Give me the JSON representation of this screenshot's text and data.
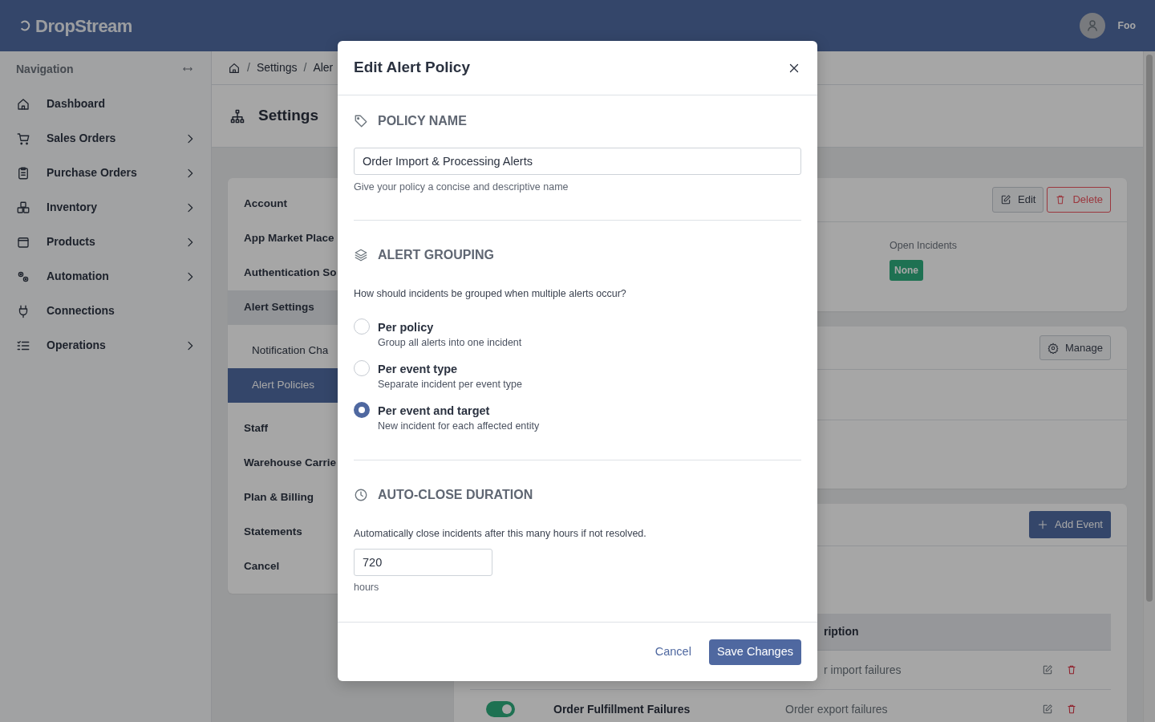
{
  "topbar": {
    "logo": "DropStream",
    "user": "Foo"
  },
  "sidebar": {
    "title": "Navigation",
    "items": [
      {
        "label": "Dashboard",
        "expandable": false
      },
      {
        "label": "Sales Orders",
        "expandable": true
      },
      {
        "label": "Purchase Orders",
        "expandable": true
      },
      {
        "label": "Inventory",
        "expandable": true
      },
      {
        "label": "Products",
        "expandable": true
      },
      {
        "label": "Automation",
        "expandable": true
      },
      {
        "label": "Connections",
        "expandable": false
      },
      {
        "label": "Operations",
        "expandable": true
      }
    ]
  },
  "breadcrumb": {
    "separator": "/",
    "items": [
      "Settings",
      "Aler"
    ]
  },
  "page_title": "Settings",
  "settings_menu": [
    {
      "label": "Account",
      "selected": false
    },
    {
      "label": "App Market Place",
      "selected": false
    },
    {
      "label": "Authentication So",
      "selected": false
    },
    {
      "label": "Alert Settings",
      "selected": false,
      "expanded": true,
      "children": [
        {
          "label": "Notification Cha",
          "selected": false
        },
        {
          "label": "Alert Policies",
          "selected": true
        }
      ]
    },
    {
      "label": "Staff",
      "selected": false
    },
    {
      "label": "Warehouse Carrie",
      "selected": false
    },
    {
      "label": "Plan & Billing",
      "selected": false
    },
    {
      "label": "Statements",
      "selected": false
    },
    {
      "label": "Cancel",
      "selected": false
    }
  ],
  "policy_card": {
    "buttons": [
      {
        "kind": "edit",
        "label": "Edit"
      },
      {
        "kind": "delete",
        "label": "Delete"
      }
    ],
    "open_incidents": {
      "label": "Open Incidents",
      "value": "None"
    }
  },
  "channels_card": {
    "button": "Manage"
  },
  "events_card": {
    "button": "Add Event",
    "table": {
      "columns": [
        {
          "label": "ription",
          "partial": true
        }
      ],
      "rows": [
        {
          "description": "r import failures",
          "partial": true
        },
        {
          "enabled": true,
          "name": "Order Fulfillment Failures",
          "description": "Order export failures",
          "partial": false
        }
      ]
    }
  },
  "dialog": {
    "title": "Edit Alert Policy",
    "sections": [
      {
        "kind": "name",
        "heading": "POLICY NAME",
        "value": "Order Import & Processing Alerts",
        "help": "Give your policy a concise and descriptive name"
      },
      {
        "kind": "grouping",
        "heading": "ALERT GROUPING",
        "question": "How should incidents be grouped when multiple alerts occur?",
        "options": [
          {
            "label": "Per policy",
            "description": "Group all alerts into one incident",
            "selected": false
          },
          {
            "label": "Per event type",
            "description": "Separate incident per event type",
            "selected": false
          },
          {
            "label": "Per event and target",
            "description": "New incident for each affected entity",
            "selected": true
          }
        ]
      },
      {
        "kind": "duration",
        "heading": "AUTO-CLOSE DURATION",
        "question": "Automatically close incidents after this many hours if not resolved.",
        "value": "720",
        "unit": "hours"
      }
    ],
    "cancel": "Cancel",
    "save": "Save Changes"
  }
}
